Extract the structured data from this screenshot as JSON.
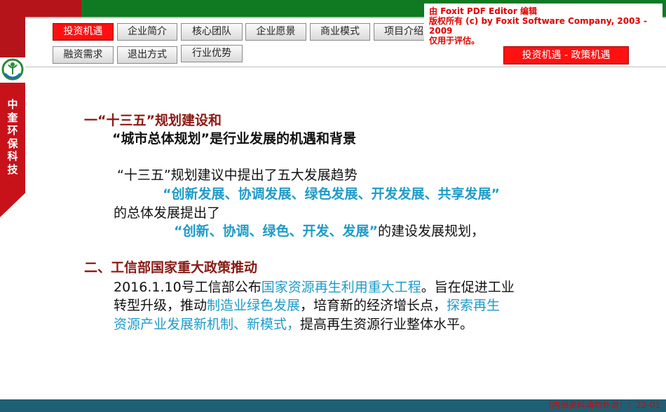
{
  "nav": {
    "row1": [
      "投资机遇",
      "企业简介",
      "核心团队",
      "企业愿景",
      "商业模式",
      "项目介绍"
    ],
    "row2": [
      "融资需求",
      "退出方式",
      "行业优势"
    ],
    "active": "投资机遇"
  },
  "sidebar": {
    "company_name": "中奎环保科技"
  },
  "breadcrumb": "投资机遇  -  政策机遇",
  "watermark": {
    "line1": "由 Foxit PDF Editor 编辑",
    "line2": "版权所有 (c) by Foxit Software Company, 2003 - 2009",
    "line3": "仅用于评估。"
  },
  "content": {
    "s1_title_a": "一“十三五”规划建设和",
    "s1_title_b": "“城市总体规划”是行业发展的机遇和背景",
    "p1": "“十三五”规划建议中提出了五大发展趋势",
    "p2": "“创新发展、协调发展、绿色发展、开发发展、共享发展”",
    "p3": "的总体发展提出了",
    "p4_blue": "“创新、协调、绿色、开发、发展”",
    "p4_rest": "的建设发展规划，",
    "s2_title": "二、工信部国家重大政策推动",
    "l1_a": "2016.1.10号工信部公布",
    "l1_b": "国家资源再生利用重大工程",
    "l1_c": "。旨在促进工业",
    "l2_a": "转型升级，推动",
    "l2_b": "制造业绿色发展",
    "l2_c": "，培育新的经济增长点，",
    "l2_d": "探索再生",
    "l3_a": "资源产业发展新机制、新模式，",
    "l3_b": "提高再生资源行业整体水平。"
  },
  "footer": {
    "text": "（内部资料请勿外泄！）22-01"
  },
  "colors": {
    "brand_red": "#b4141a",
    "brand_green": "#0f7a22",
    "accent_blue": "#1e9bc8",
    "heading_red": "#8a1a14",
    "footer_teal": "#1f5f74"
  }
}
